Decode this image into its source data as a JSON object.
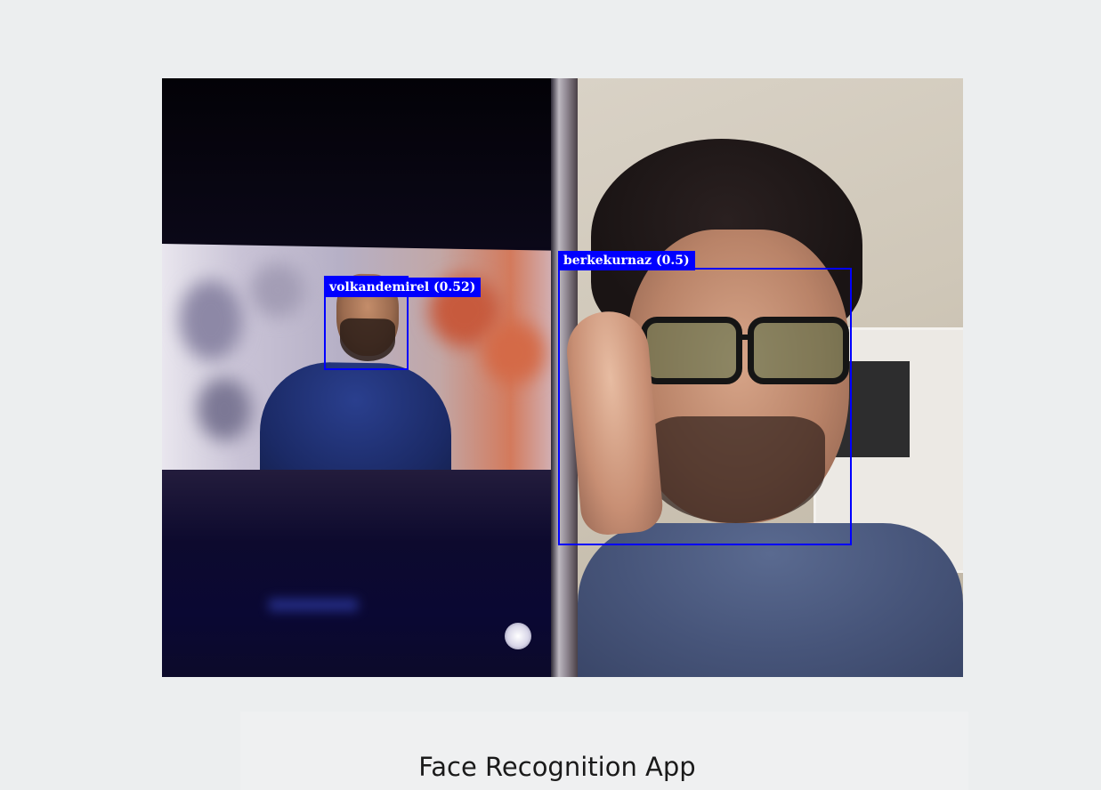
{
  "app": {
    "title": "Face Recognition App"
  },
  "video_feed": {
    "detections": [
      {
        "name_label": "volkandemirel (0.52)"
      },
      {
        "name_label": "berkekurnaz (0.5)"
      }
    ]
  },
  "colors": {
    "detection_box": "#0000ff",
    "detection_label_text": "#ffffff",
    "page_background": "#eceeef"
  }
}
